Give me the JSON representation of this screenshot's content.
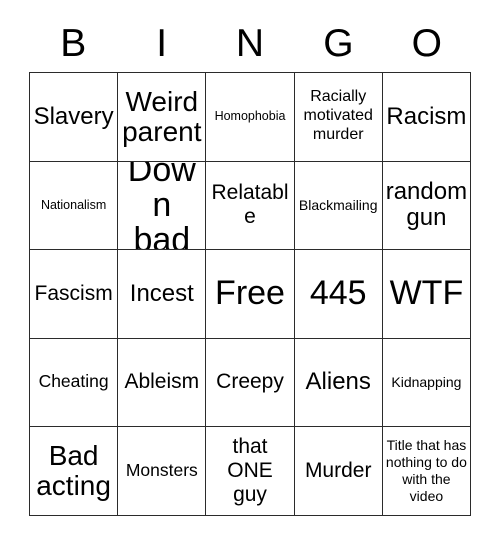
{
  "card": {
    "header_letters": [
      "B",
      "I",
      "N",
      "G",
      "O"
    ],
    "free_space_label": "Free",
    "border_color": "#2b2b2b",
    "background_color": "#ffffff",
    "text_color": "#000000",
    "rows": [
      [
        {
          "text": "Slavery",
          "size": "sz-l"
        },
        {
          "text": "Weird parent",
          "size": "sz-xl"
        },
        {
          "text": "Homophobia",
          "size": "sz-xs"
        },
        {
          "text": "Racially motivated murder",
          "size": "sz-sm"
        },
        {
          "text": "Racism",
          "size": "sz-l"
        }
      ],
      [
        {
          "text": "Nationalism",
          "size": "sz-xs"
        },
        {
          "text": "Down bad",
          "size": "sz-xxl"
        },
        {
          "text": "Relatable",
          "size": "sz-ml"
        },
        {
          "text": "Blackmailing",
          "size": "sz-s"
        },
        {
          "text": "random gun",
          "size": "sz-l"
        }
      ],
      [
        {
          "text": "Fascism",
          "size": "sz-ml"
        },
        {
          "text": "Incest",
          "size": "sz-l"
        },
        {
          "text": "Free",
          "size": "sz-xxl"
        },
        {
          "text": "445",
          "size": "sz-xxl"
        },
        {
          "text": "WTF",
          "size": "sz-xxl"
        }
      ],
      [
        {
          "text": "Cheating",
          "size": "sz-m"
        },
        {
          "text": "Ableism",
          "size": "sz-ml"
        },
        {
          "text": "Creepy",
          "size": "sz-ml"
        },
        {
          "text": "Aliens",
          "size": "sz-l"
        },
        {
          "text": "Kidnapping",
          "size": "sz-s"
        }
      ],
      [
        {
          "text": "Bad acting",
          "size": "sz-xl"
        },
        {
          "text": "Monsters",
          "size": "sz-m"
        },
        {
          "text": "that ONE guy",
          "size": "sz-ml"
        },
        {
          "text": "Murder",
          "size": "sz-ml"
        },
        {
          "text": "Title that has nothing to do with the video",
          "size": "sz-s"
        }
      ]
    ]
  }
}
